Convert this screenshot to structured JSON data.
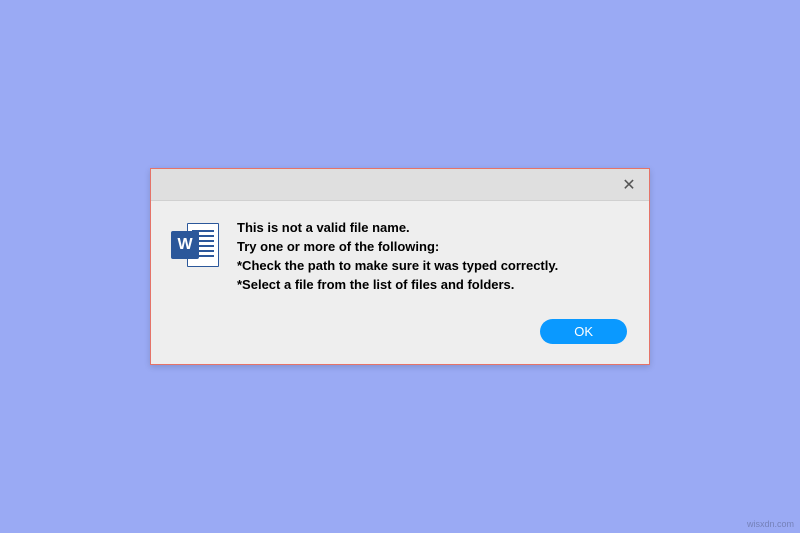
{
  "dialog": {
    "close_label": "✕",
    "icon": {
      "letter": "W"
    },
    "message": {
      "line1": "This is not a valid file name.",
      "line2": "Try one or more of the following:",
      "line3": "*Check the path to make sure it was typed correctly.",
      "line4": "*Select a file from the list of files and folders."
    },
    "ok_label": "OK"
  },
  "watermark": "wisxdn.com"
}
